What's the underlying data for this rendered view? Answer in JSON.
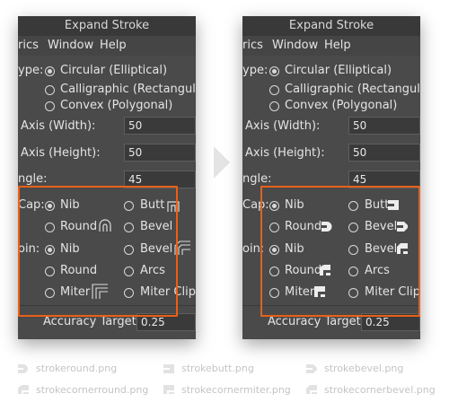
{
  "title": "Expand Stroke",
  "menu": {
    "metrics_fragment": "rics",
    "window": "Window",
    "help": "Help"
  },
  "type_label": "ype:",
  "types": [
    "Circular (Elliptical)",
    "Calligraphic (Rectangular)",
    "Convex (Polygonal)"
  ],
  "type_selected": 0,
  "width_label": "Axis (Width):",
  "width_value": "50",
  "height_label": "Axis (Height):",
  "height_value": "50",
  "angle_label": "ngle:",
  "angle_value": "45",
  "cap_label": "Cap:",
  "join_label": "oin:",
  "cap": {
    "nib": "Nib",
    "butt": "Butt",
    "round": "Round",
    "bevel": "Bevel"
  },
  "join": {
    "nib": "Nib",
    "bevel": "Bevel",
    "round": "Round",
    "arcs": "Arcs",
    "miter": "Miter",
    "miter_clip": "Miter Clip"
  },
  "accuracy_label": "Accuracy Target:",
  "accuracy_value": "0.25",
  "files": {
    "row1": [
      "strokeround.png",
      "strokebutt.png",
      "strokebevel.png"
    ],
    "row2": [
      "strokecornerround.png",
      "strokecornermiter.png",
      "strokecornerbevel.png"
    ]
  },
  "colors": {
    "highlight": "#e8601a",
    "panel": "#4a4a4a"
  }
}
